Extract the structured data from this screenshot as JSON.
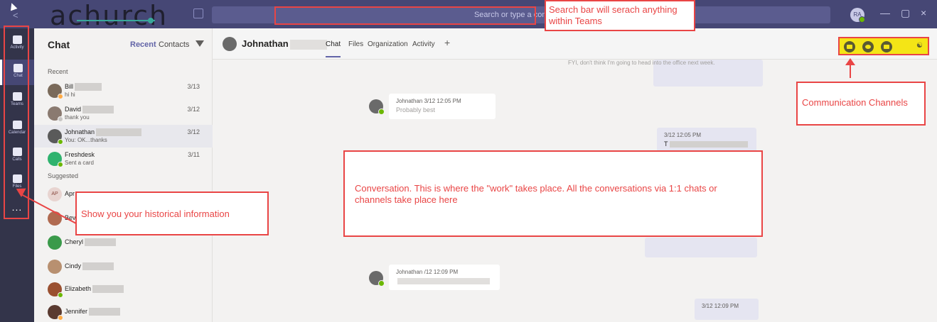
{
  "titlebar": {
    "logo": "achurch",
    "search_placeholder": "Search or type a command",
    "user_initials": "RA"
  },
  "rail": {
    "items": [
      {
        "label": "Activity"
      },
      {
        "label": "Chat"
      },
      {
        "label": "Teams"
      },
      {
        "label": "Calendar"
      },
      {
        "label": "Calls"
      },
      {
        "label": "Files"
      }
    ],
    "more": "..."
  },
  "chatlist": {
    "title": "Chat",
    "tab_recent": "Recent",
    "tab_contacts": "Contacts",
    "recent_label": "Recent",
    "suggested_label": "Suggested",
    "recent": [
      {
        "name": "Bill",
        "preview": "hi hi",
        "date": "3/13"
      },
      {
        "name": "David",
        "preview": "thank you",
        "date": "3/12"
      },
      {
        "name": "Johnathan",
        "preview": "You: OK...thanks",
        "date": "3/12"
      },
      {
        "name": "Freshdesk",
        "preview": "Sent a card",
        "date": "3/11"
      }
    ],
    "suggested": [
      {
        "name": "Apr"
      },
      {
        "name": "Bev"
      },
      {
        "name": "Cheryl"
      },
      {
        "name": "Cindy"
      },
      {
        "name": "Elizabeth"
      },
      {
        "name": "Jennifer"
      }
    ]
  },
  "conversation": {
    "contact_name": "Johnathan",
    "tabs": [
      "Chat",
      "Files",
      "Organization",
      "Activity"
    ],
    "add_tab": "+",
    "messages": [
      {
        "meta": "",
        "body": "FYI, don't think I'm going to head into the office next week."
      },
      {
        "meta": "Johnathan 3/12 12:05 PM",
        "body": "Probably best"
      },
      {
        "meta": "3/12 12:05 PM",
        "body": "T"
      },
      {
        "meta": "Johnathan /12 12:09 PM",
        "body": ""
      },
      {
        "meta": "3/12 12:09 PM",
        "body": ""
      }
    ]
  },
  "annotations": {
    "search": "Search bar will serach anything within Teams",
    "comm": "Communication Channels",
    "conversation": "Conversation.  This is where the \"work\" takes place.  All the conversations via 1:1 chats or channels take place here",
    "history": "Show you your historical information"
  },
  "colors": {
    "titlebar": "#464775",
    "rail": "#33344a",
    "accent": "#6264a7",
    "annotation": "#e94545",
    "highlight": "#f4e516"
  }
}
